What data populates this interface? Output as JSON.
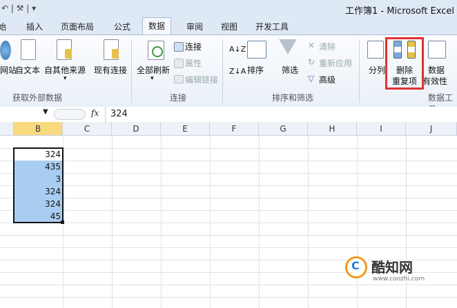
{
  "window": {
    "quick_access": "↶ | ⚒ | ▾",
    "title": "工作簿1 - Microsoft Excel"
  },
  "tabs": [
    {
      "label": "始"
    },
    {
      "label": "插入"
    },
    {
      "label": "页面布局"
    },
    {
      "label": "公式"
    },
    {
      "label": "数据",
      "active": true
    },
    {
      "label": "审阅"
    },
    {
      "label": "视图"
    },
    {
      "label": "开发工具"
    }
  ],
  "ribbon": {
    "groups": {
      "external": "获取外部数据",
      "connections": "连接",
      "sort_filter": "排序和筛选",
      "tools": "数据工具"
    },
    "buttons": {
      "web": "网站",
      "text": "自文本",
      "other": "自其他来源",
      "existing": "现有连接",
      "refresh_all": "全部刷新",
      "connections": "连接",
      "properties": "属性",
      "edit_links": "编辑链接",
      "sort": "排序",
      "filter": "筛选",
      "clear": "清除",
      "reapply": "重新应用",
      "advanced": "高级",
      "text_to_columns": "分列",
      "remove_dup_1": "删除",
      "remove_dup_2": "重复项",
      "validation_1": "数据",
      "validation_2": "有效性"
    }
  },
  "formula_bar": {
    "fx": "fx",
    "value": "324"
  },
  "columns": [
    "B",
    "C",
    "D",
    "E",
    "F",
    "G",
    "H",
    "I",
    "J"
  ],
  "cells": [
    "324",
    "435",
    "3",
    "324",
    "324",
    "45"
  ],
  "watermark": {
    "name": "酷知网",
    "url": "www.coozhi.com"
  },
  "colors": {
    "selection": "#a9cdf0",
    "highlight_border": "#e03030",
    "active_header": "#f9d97e"
  }
}
